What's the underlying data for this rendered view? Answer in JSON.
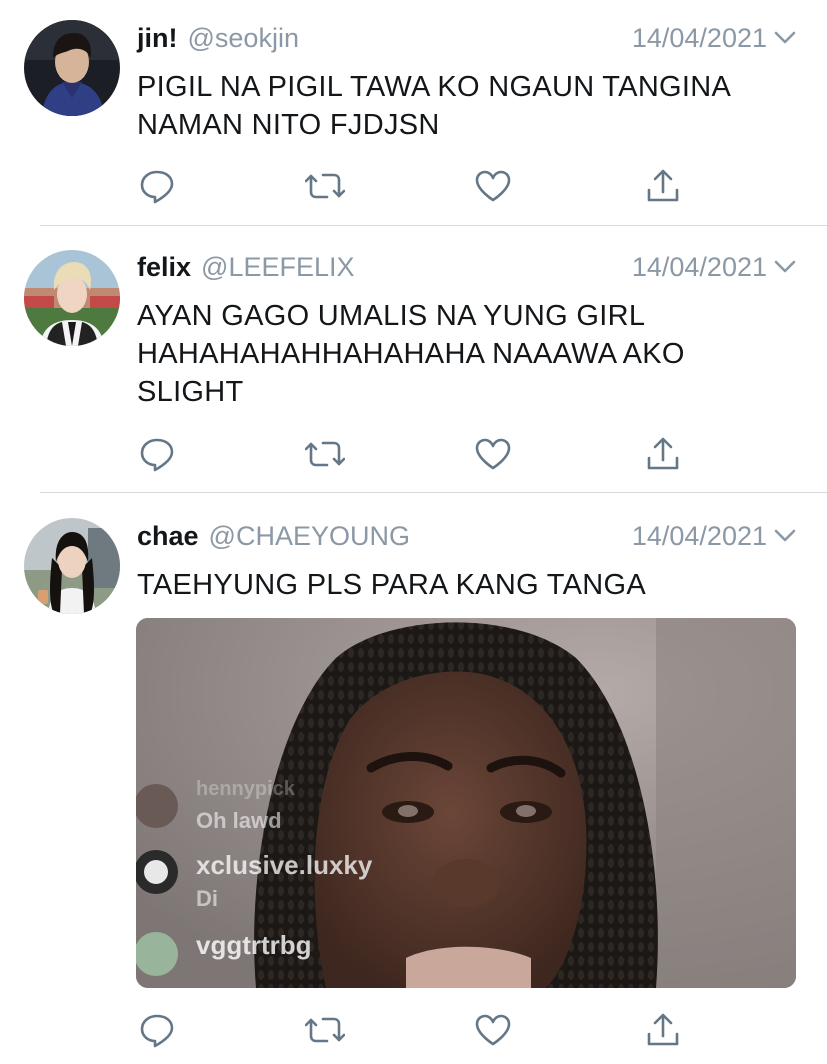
{
  "tweets": [
    {
      "name": "jin!",
      "handle": "@seokjin",
      "date": "14/04/2021",
      "text": "PIGIL NA PIGIL TAWA KO NGAUN TANGINA NAMAN NITO FJDJSN"
    },
    {
      "name": "felix",
      "handle": "@LEEFELIX",
      "date": "14/04/2021",
      "text": "AYAN GAGO UMALIS NA YUNG GIRL HAHAHAHAHHAHAHAHA NAAAWA AKO SLIGHT"
    },
    {
      "name": "chae",
      "handle": "@CHAEYOUNG",
      "date": "14/04/2021",
      "text": "TAEHYUNG PLS PARA KANG TANGA",
      "media": {
        "overlay_comments": [
          "hennypick",
          "Oh lawd",
          "xclusive.luxky",
          "Di",
          "vggtrtrbg"
        ]
      }
    }
  ],
  "icons": {
    "reply": "reply-icon",
    "retweet": "retweet-icon",
    "like": "like-icon",
    "share": "share-icon",
    "caret": "chevron-down-icon"
  },
  "colors": {
    "text": "#14171a",
    "secondary": "#8b98a5",
    "icon": "#657786",
    "divider": "#d6dadf"
  }
}
